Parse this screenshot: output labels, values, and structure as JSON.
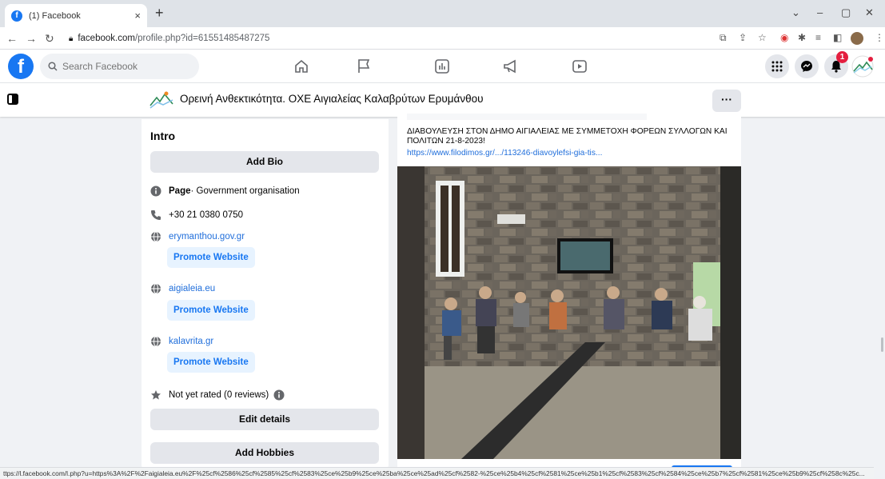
{
  "browser": {
    "tab_title": "(1) Facebook",
    "tab_close": "×",
    "new_tab": "+",
    "url_domain": "facebook.com",
    "url_path": "/profile.php?id=61551485487275",
    "status_url": "ttps://l.facebook.com/l.php?u=https%3A%2F%2Faigialeia.eu%2F%25cf%2586%25cf%2585%25cf%2583%25ce%25b9%25ce%25ba%25ce%25ad%25cf%2582-%25ce%25b4%25cf%2581%25ce%25b1%25cf%2583%25cf%2584%25ce%25b7%25cf%2581%25ce%25b9%25cf%258c%25c..."
  },
  "facebook": {
    "search_placeholder": "Search Facebook",
    "notification_count": "1",
    "brand_color": "#1877f2"
  },
  "page": {
    "name": "Ορεινή Ανθεκτικότητα. ΟΧΕ Αιγιαλείας Καλαβρύτων Ερυμάνθου",
    "more_label": "···"
  },
  "intro": {
    "title": "Intro",
    "add_bio": "Add Bio",
    "category_bold": "Page",
    "category_rest": " · Government organisation",
    "phone": "+30 21 0380 0750",
    "websites": [
      {
        "url": "erymanthou.gov.gr",
        "promote": "Promote Website"
      },
      {
        "url": "aigialeia.eu",
        "promote": "Promote Website"
      },
      {
        "url": "kalavrita.gr",
        "promote": "Promote Website"
      }
    ],
    "rating": "Not yet rated (0 reviews)",
    "edit_details": "Edit details",
    "add_hobbies": "Add Hobbies"
  },
  "post": {
    "text": "ΔΙΑΒΟΥΛΕΥΣΗ ΣΤΟΝ ΔΗΜΟ ΑΙΓΙΑΛΕΙΑΣ ΜΕ ΣΥΜΜΕΤΟΧΗ ΦΟΡΕΩΝ ΣΥΛΛΟΓΩΝ ΚΑΙ ΠΟΛΙΤΩΝ 21-8-2023!",
    "link": "https://www.filodimos.gr/.../113246-diavoylefsi-gia-tis..."
  }
}
